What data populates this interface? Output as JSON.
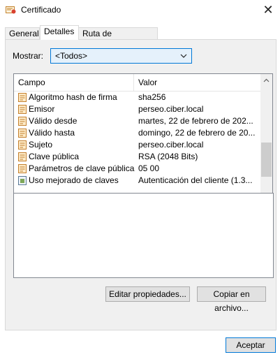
{
  "window": {
    "title": "Certificado",
    "close_glyph": "✕"
  },
  "tabs": [
    {
      "label": "General"
    },
    {
      "label": "Detalles"
    },
    {
      "label": "Ruta de certificación"
    }
  ],
  "show": {
    "label": "Mostrar:",
    "selected": "<Todos>"
  },
  "table": {
    "columns": [
      "Campo",
      "Valor"
    ],
    "rows": [
      {
        "campo": "Algoritmo hash de firma",
        "valor": "sha256",
        "icon": "certificate-field-icon"
      },
      {
        "campo": "Emisor",
        "valor": "perseo.ciber.local",
        "icon": "certificate-field-icon"
      },
      {
        "campo": "Válido desde",
        "valor": "martes, 22 de febrero de 202...",
        "icon": "certificate-field-icon"
      },
      {
        "campo": "Válido hasta",
        "valor": "domingo, 22 de febrero de 20...",
        "icon": "certificate-field-icon"
      },
      {
        "campo": "Sujeto",
        "valor": "perseo.ciber.local",
        "icon": "certificate-field-icon"
      },
      {
        "campo": "Clave pública",
        "valor": "RSA (2048 Bits)",
        "icon": "certificate-field-icon"
      },
      {
        "campo": "Parámetros de clave pública",
        "valor": "05 00",
        "icon": "certificate-field-icon"
      },
      {
        "campo": "Uso mejorado de claves",
        "valor": "Autenticación del cliente (1.3...",
        "icon": "extension-field-icon"
      }
    ]
  },
  "buttons": {
    "edit": "Editar propiedades...",
    "copy": "Copiar en archivo...",
    "ok": "Aceptar"
  },
  "colors": {
    "accent": "#0078d7",
    "panel": "#f0f0f0",
    "field_icon": "#e8c79a"
  }
}
